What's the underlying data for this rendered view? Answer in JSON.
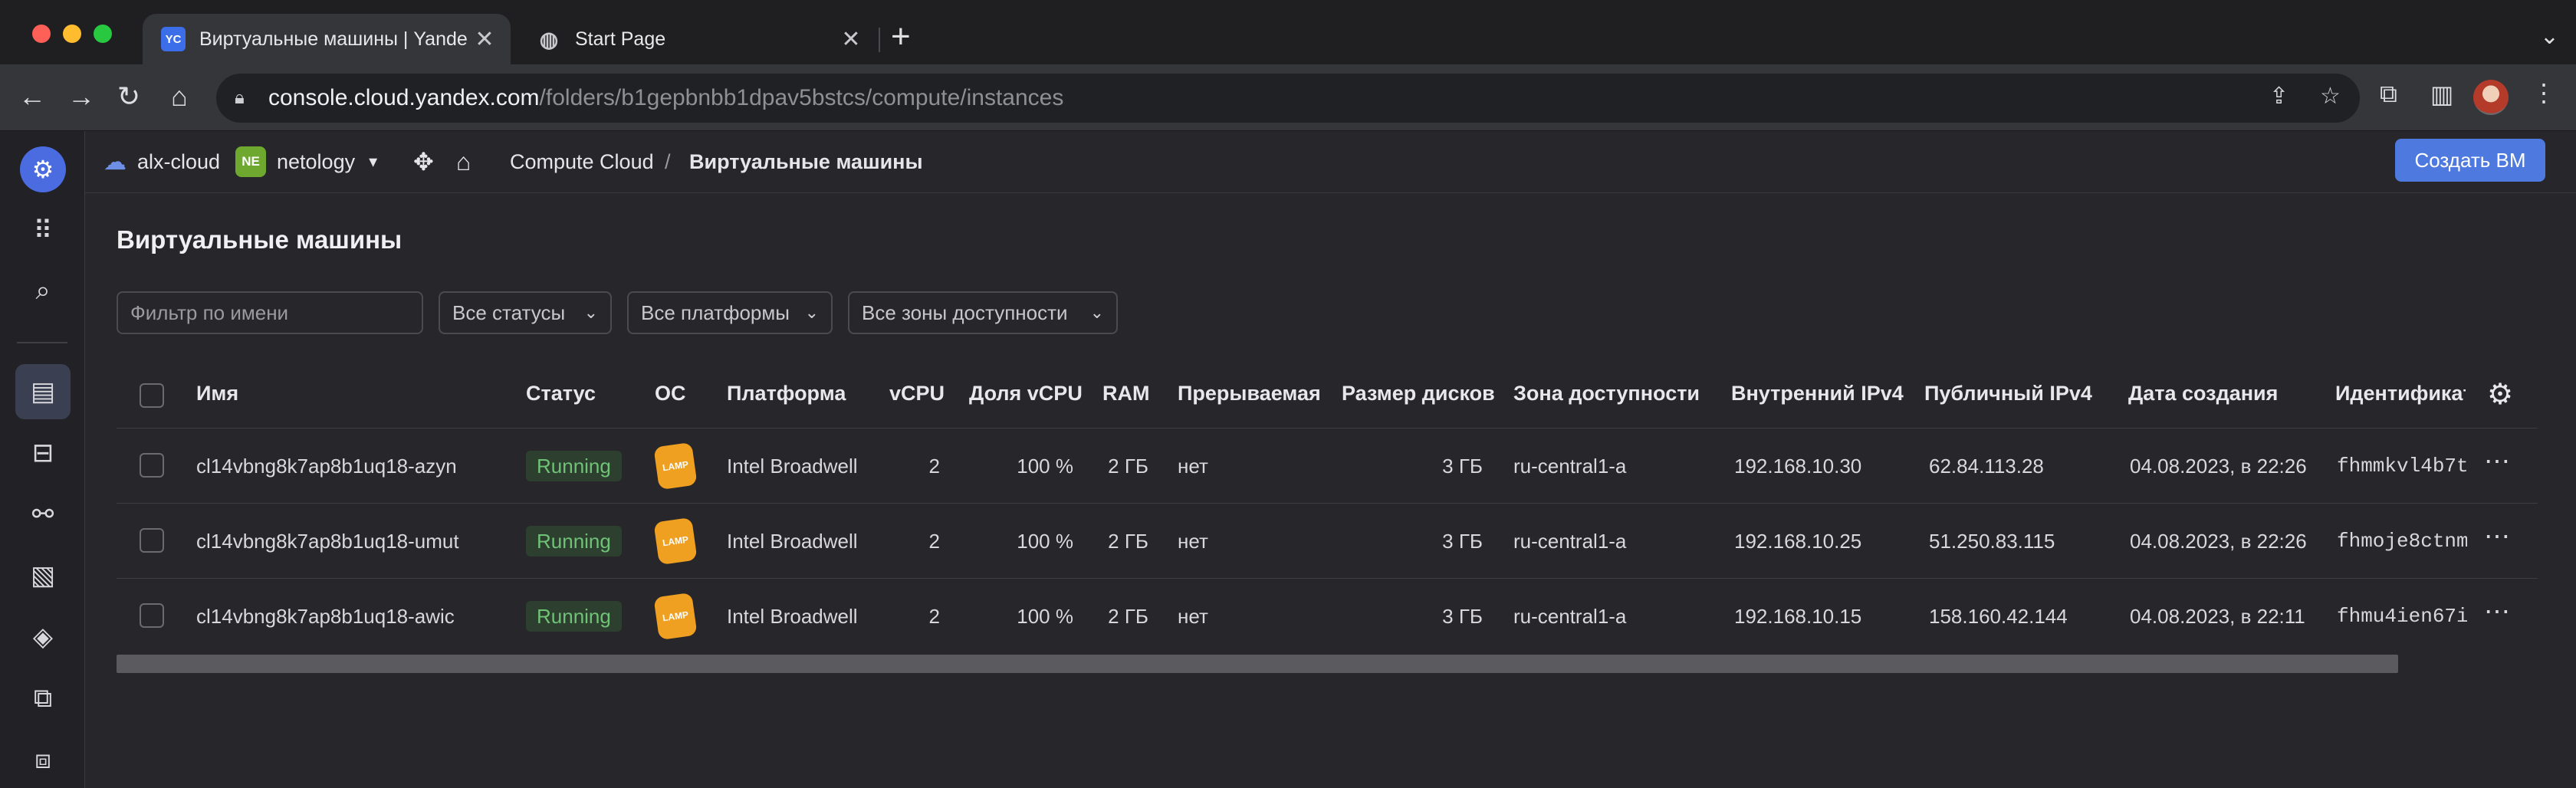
{
  "browser": {
    "tabs": [
      {
        "favicon": "YC",
        "title": "Виртуальные машины | Yande"
      },
      {
        "favicon": "globe-icon",
        "title": "Start Page"
      }
    ],
    "url_host": "console.cloud.yandex.com",
    "url_path": "/folders/b1gepbnbb1dpav5bstcs/compute/instances"
  },
  "header": {
    "cloud": "alx-cloud",
    "folder_badge": "NE",
    "folder": "netology",
    "breadcrumb_service": "Compute Cloud",
    "breadcrumb_sep": "/",
    "breadcrumb_page": "Виртуальные машины",
    "create_button": "Создать ВМ"
  },
  "page": {
    "title": "Виртуальные машины",
    "filters": {
      "name_placeholder": "Фильтр по имени",
      "status": "Все статусы",
      "platform": "Все платформы",
      "zone": "Все зоны доступности"
    }
  },
  "table": {
    "columns": [
      "Имя",
      "Статус",
      "ОС",
      "Платформа",
      "vCPU",
      "Доля vCPU",
      "RAM",
      "Прерываемая",
      "Размер дисков",
      "Зона доступности",
      "Внутренний IPv4",
      "Публичный IPv4",
      "Дата создания",
      "Идентификат"
    ],
    "rows": [
      {
        "name": "cl14vbng8k7ap8b1uq18-azyn",
        "status": "Running",
        "os": "LAMP",
        "platform": "Intel Broadwell",
        "vcpu": "2",
        "vcpu_share": "100 %",
        "ram": "2 ГБ",
        "preemptible": "нет",
        "disk": "3 ГБ",
        "zone": "ru-central1-a",
        "internal_ip": "192.168.10.30",
        "public_ip": "62.84.113.28",
        "created": "04.08.2023, в 22:26",
        "id": "fhmmkvl4b7t"
      },
      {
        "name": "cl14vbng8k7ap8b1uq18-umut",
        "status": "Running",
        "os": "LAMP",
        "platform": "Intel Broadwell",
        "vcpu": "2",
        "vcpu_share": "100 %",
        "ram": "2 ГБ",
        "preemptible": "нет",
        "disk": "3 ГБ",
        "zone": "ru-central1-a",
        "internal_ip": "192.168.10.25",
        "public_ip": "51.250.83.115",
        "created": "04.08.2023, в 22:26",
        "id": "fhmoje8ctnm"
      },
      {
        "name": "cl14vbng8k7ap8b1uq18-awic",
        "status": "Running",
        "os": "LAMP",
        "platform": "Intel Broadwell",
        "vcpu": "2",
        "vcpu_share": "100 %",
        "ram": "2 ГБ",
        "preemptible": "нет",
        "disk": "3 ГБ",
        "zone": "ru-central1-a",
        "internal_ip": "192.168.10.15",
        "public_ip": "158.160.42.144",
        "created": "04.08.2023, в 22:11",
        "id": "fhmu4ien67i"
      }
    ]
  },
  "colors": {
    "accent": "#4e7ae0",
    "running_text": "#6fc276",
    "running_bg": "#2d4030",
    "folder_badge": "#6ea82e",
    "lamp_icon": "#f0a020"
  }
}
